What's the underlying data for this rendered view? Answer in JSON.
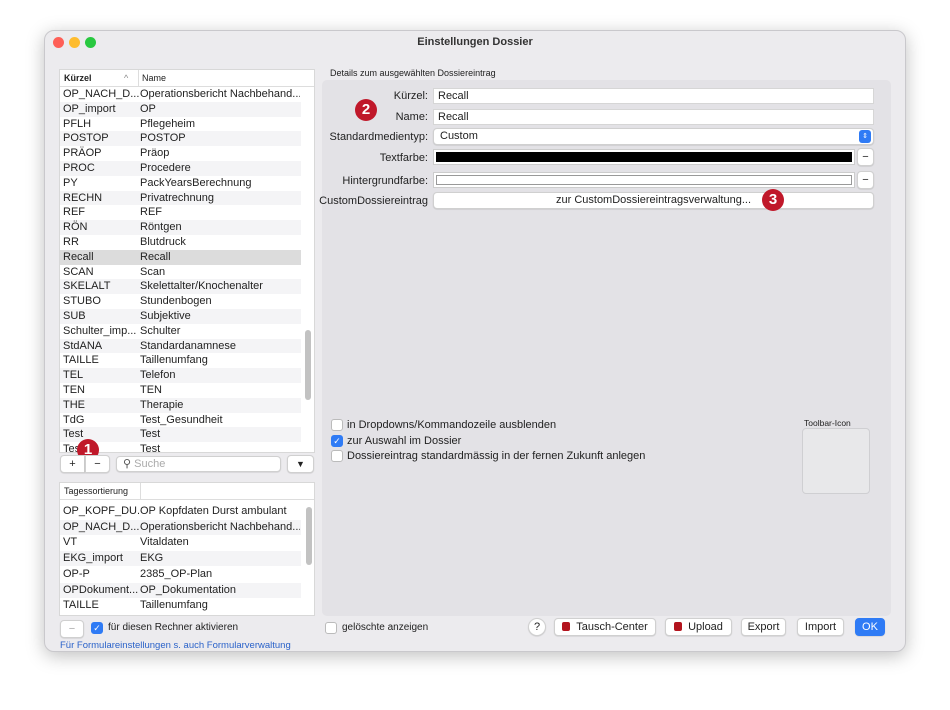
{
  "window": {
    "title": "Einstellungen Dossier"
  },
  "list": {
    "headers": [
      "Kürzel",
      "Name"
    ],
    "rows": [
      [
        "OP_NACH_D...",
        "Operationsbericht Nachbehand..."
      ],
      [
        "OP_import",
        "OP"
      ],
      [
        "PFLH",
        "Pflegeheim"
      ],
      [
        "POSTOP",
        "POSTOP"
      ],
      [
        "PRÄOP",
        "Präop"
      ],
      [
        "PROC",
        "Procedere"
      ],
      [
        "PY",
        "PackYearsBerechnung"
      ],
      [
        "RECHN",
        "Privatrechnung"
      ],
      [
        "REF",
        "REF"
      ],
      [
        "RÖN",
        "Röntgen"
      ],
      [
        "RR",
        "Blutdruck"
      ],
      [
        "Recall",
        "Recall"
      ],
      [
        "SCAN",
        "Scan"
      ],
      [
        "SKELALT",
        "Skelettalter/Knochenalter"
      ],
      [
        "STUBO",
        "Stundenbogen"
      ],
      [
        "SUB",
        "Subjektive"
      ],
      [
        "Schulter_imp...",
        "Schulter"
      ],
      [
        "StdANA",
        "Standardanamnese"
      ],
      [
        "TAILLE",
        "Taillenumfang"
      ],
      [
        "TEL",
        "Telefon"
      ],
      [
        "TEN",
        "TEN"
      ],
      [
        "THE",
        "Therapie"
      ],
      [
        "TdG",
        "Test_Gesundheit"
      ],
      [
        "Test",
        "Test"
      ],
      [
        "Test",
        "Test"
      ]
    ],
    "selected": "Recall",
    "add": "+",
    "remove": "−",
    "search_placeholder": "Suche"
  },
  "day_list": {
    "header": "Tagessortierung",
    "rows": [
      [
        "OP_KOPF_DU...",
        "OP Kopfdaten Durst ambulant"
      ],
      [
        "OP_NACH_D...",
        "Operationsbericht Nachbehand..."
      ],
      [
        "VT",
        "Vitaldaten"
      ],
      [
        "EKG_import",
        "EKG"
      ],
      [
        "OP-P",
        "2385_OP-Plan"
      ],
      [
        "OPDokument...",
        "OP_Dokumentation"
      ],
      [
        "TAILLE",
        "Taillenumfang"
      ]
    ],
    "remove": "−",
    "activate_label": "für diesen Rechner aktivieren",
    "activate_checked": true,
    "link": "Für Formulareinstellungen s. auch Formularverwaltung"
  },
  "details": {
    "section_title": "Details zum ausgewählten Dossiereintrag",
    "kuerzel_label": "Kürzel:",
    "kuerzel": "Recall",
    "name_label": "Name:",
    "name": "Recall",
    "medientyp_label": "Standardmedientyp:",
    "medientyp": "Custom",
    "textfarbe_label": "Textfarbe:",
    "textfarbe": "#000000",
    "hintergrund_label": "Hintergrundfarbe:",
    "hintergrund": "#ffffff",
    "custom_label": "CustomDossiereintrag",
    "custom_button": "zur CustomDossiereintragsverwaltung...",
    "options": [
      {
        "label": "in Dropdowns/Kommandozeile ausblenden",
        "checked": false
      },
      {
        "label": "zur Auswahl im Dossier",
        "checked": true
      },
      {
        "label": "Dossiereintrag standardmässig in der fernen Zukunft anlegen",
        "checked": false
      }
    ],
    "toolbar_icon_label": "Toolbar-Icon"
  },
  "footer": {
    "show_deleted": "gelöschte anzeigen",
    "help": "?",
    "tausch": "Tausch-Center",
    "upload": "Upload",
    "export": "Export",
    "import": "Import",
    "ok": "OK"
  },
  "badges": [
    "1",
    "2",
    "3"
  ],
  "colors": {
    "accent": "#2f7bf5",
    "badge": "#c0182a"
  }
}
